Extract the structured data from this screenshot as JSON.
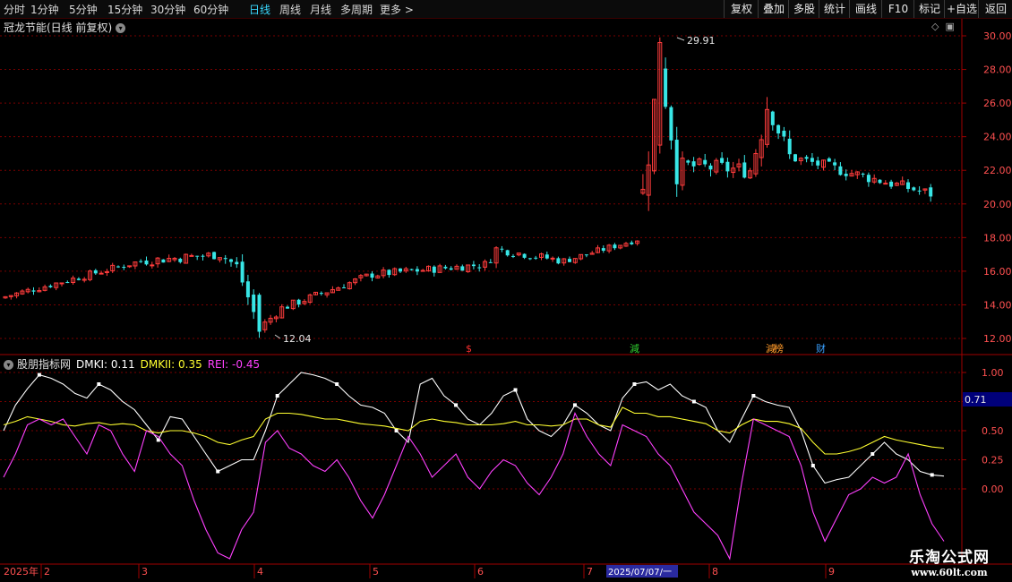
{
  "toolbar": {
    "periods": [
      "分时",
      "1分钟",
      "5分钟",
      "15分钟",
      "30分钟",
      "60分钟",
      "日线",
      "周线",
      "月线",
      "多周期",
      "更多 >"
    ],
    "active_period": "日线",
    "actions": [
      "复权",
      "叠加",
      "多股",
      "统计",
      "画线",
      "F10",
      "标记",
      "+自选",
      "返回"
    ]
  },
  "main_chart": {
    "title": "冠龙节能(日线 前复权)",
    "y_ticks": [
      "30.00",
      "28.00",
      "26.00",
      "24.00",
      "22.00",
      "20.00",
      "18.00",
      "16.00",
      "14.00",
      "12.00"
    ],
    "high_label": "29.91",
    "low_label": "12.04",
    "markers": [
      {
        "text": "$",
        "color": "#ff3030"
      },
      {
        "text": "減",
        "color": "#30d030"
      },
      {
        "text": "減",
        "color": "#ff9a2a"
      },
      {
        "text": "榜",
        "color": "#ff9a2a"
      },
      {
        "text": "财",
        "color": "#39a0ff"
      }
    ]
  },
  "indicator": {
    "name": "股朋指标网",
    "dmki": "DMKI: 0.11",
    "dmkii": "DMKII: 0.35",
    "rei": "REI: -0.45",
    "colors": {
      "dmki": "#ffffff",
      "dmkii": "#ffff30",
      "rei": "#ff40ff"
    },
    "y_ticks": [
      "1.00",
      "0.75",
      "0.50",
      "0.25",
      "0.00"
    ],
    "current_value": "0.71"
  },
  "time_axis": {
    "labels": [
      "2025年",
      "2",
      "3",
      "4",
      "5",
      "6",
      "7",
      "8",
      "9"
    ],
    "cursor_label": "2025/07/07/一"
  },
  "watermark": {
    "line1": "乐淘公式网",
    "line2": "www.60lt.com"
  },
  "chart_data": {
    "type": "candlestick",
    "price_range": [
      11.5,
      30.6
    ],
    "high": 29.91,
    "low": 12.04,
    "segments": [
      {
        "from": [
          0,
          14.4
        ],
        "to": [
          25,
          16.6
        ],
        "vol": 0.22
      },
      {
        "to": [
          39,
          17.0
        ],
        "vol": 0.3
      },
      {
        "to": [
          42,
          16.3
        ],
        "vol": 0.35
      },
      {
        "to": [
          46,
          12.6
        ],
        "vol": 0.55
      },
      {
        "to": [
          50,
          13.8
        ],
        "vol": 0.25
      },
      {
        "to": [
          66,
          15.8
        ],
        "vol": 0.25
      },
      {
        "to": [
          86,
          16.4
        ],
        "vol": 0.25
      },
      {
        "to": [
          88,
          17.3
        ],
        "vol": 0.35
      },
      {
        "to": [
          100,
          16.6
        ],
        "vol": 0.25
      },
      {
        "to": [
          113,
          17.9
        ],
        "vol": 0.2
      },
      {
        "gap": true,
        "to": [
          117,
          28.5
        ],
        "vol": 1.2
      },
      {
        "to": [
          120,
          22.3
        ],
        "vol": 1.2
      },
      {
        "to": [
          133,
          22.0
        ],
        "vol": 0.5
      },
      {
        "to": [
          136,
          26.0
        ],
        "vol": 1.2
      },
      {
        "to": [
          140,
          22.8
        ],
        "vol": 0.6
      },
      {
        "to": [
          165,
          20.6
        ],
        "vol": 0.35
      }
    ],
    "indicator_series": [
      {
        "name": "DMKI",
        "values": [
          0.5,
          0.72,
          0.86,
          0.98,
          0.95,
          0.9,
          0.82,
          0.78,
          0.9,
          0.85,
          0.75,
          0.68,
          0.55,
          0.42,
          0.62,
          0.6,
          0.45,
          0.3,
          0.15,
          0.2,
          0.25,
          0.25,
          0.5,
          0.8,
          0.9,
          1.0,
          0.98,
          0.95,
          0.9,
          0.8,
          0.72,
          0.7,
          0.65,
          0.5,
          0.4,
          0.9,
          0.95,
          0.8,
          0.72,
          0.6,
          0.55,
          0.65,
          0.8,
          0.85,
          0.6,
          0.5,
          0.45,
          0.55,
          0.72,
          0.65,
          0.55,
          0.5,
          0.78,
          0.9,
          0.92,
          0.85,
          0.9,
          0.8,
          0.75,
          0.7,
          0.5,
          0.4,
          0.6,
          0.8,
          0.75,
          0.72,
          0.7,
          0.5,
          0.2,
          0.05,
          0.08,
          0.1,
          0.2,
          0.3,
          0.4,
          0.3,
          0.25,
          0.15,
          0.12,
          0.11
        ]
      },
      {
        "name": "DMKII",
        "values": [
          0.55,
          0.58,
          0.62,
          0.6,
          0.58,
          0.55,
          0.54,
          0.56,
          0.57,
          0.55,
          0.56,
          0.55,
          0.5,
          0.48,
          0.5,
          0.5,
          0.48,
          0.45,
          0.4,
          0.38,
          0.42,
          0.45,
          0.6,
          0.65,
          0.65,
          0.64,
          0.62,
          0.6,
          0.6,
          0.58,
          0.56,
          0.55,
          0.54,
          0.52,
          0.5,
          0.58,
          0.6,
          0.58,
          0.57,
          0.55,
          0.55,
          0.55,
          0.56,
          0.58,
          0.55,
          0.55,
          0.54,
          0.55,
          0.6,
          0.6,
          0.55,
          0.53,
          0.7,
          0.65,
          0.65,
          0.62,
          0.62,
          0.6,
          0.58,
          0.56,
          0.5,
          0.48,
          0.55,
          0.6,
          0.58,
          0.58,
          0.56,
          0.52,
          0.4,
          0.3,
          0.3,
          0.32,
          0.35,
          0.4,
          0.45,
          0.42,
          0.4,
          0.38,
          0.36,
          0.35
        ]
      },
      {
        "name": "REI",
        "values": [
          0.1,
          0.3,
          0.55,
          0.6,
          0.55,
          0.6,
          0.45,
          0.3,
          0.55,
          0.5,
          0.3,
          0.15,
          0.5,
          0.45,
          0.3,
          0.2,
          -0.1,
          -0.35,
          -0.55,
          -0.6,
          -0.35,
          -0.2,
          0.4,
          0.5,
          0.35,
          0.3,
          0.2,
          0.15,
          0.25,
          0.1,
          -0.1,
          -0.25,
          -0.05,
          0.2,
          0.45,
          0.3,
          0.1,
          0.2,
          0.3,
          0.1,
          0.0,
          0.15,
          0.25,
          0.2,
          0.05,
          -0.05,
          0.1,
          0.3,
          0.65,
          0.45,
          0.3,
          0.2,
          0.55,
          0.5,
          0.45,
          0.3,
          0.2,
          0.0,
          -0.2,
          -0.3,
          -0.4,
          -0.6,
          0.05,
          0.6,
          0.55,
          0.5,
          0.45,
          0.2,
          -0.2,
          -0.45,
          -0.25,
          -0.05,
          0.0,
          0.1,
          0.05,
          0.1,
          0.3,
          -0.05,
          -0.3,
          -0.45
        ]
      }
    ],
    "indicator_range": [
      -0.62,
      1.12
    ]
  }
}
